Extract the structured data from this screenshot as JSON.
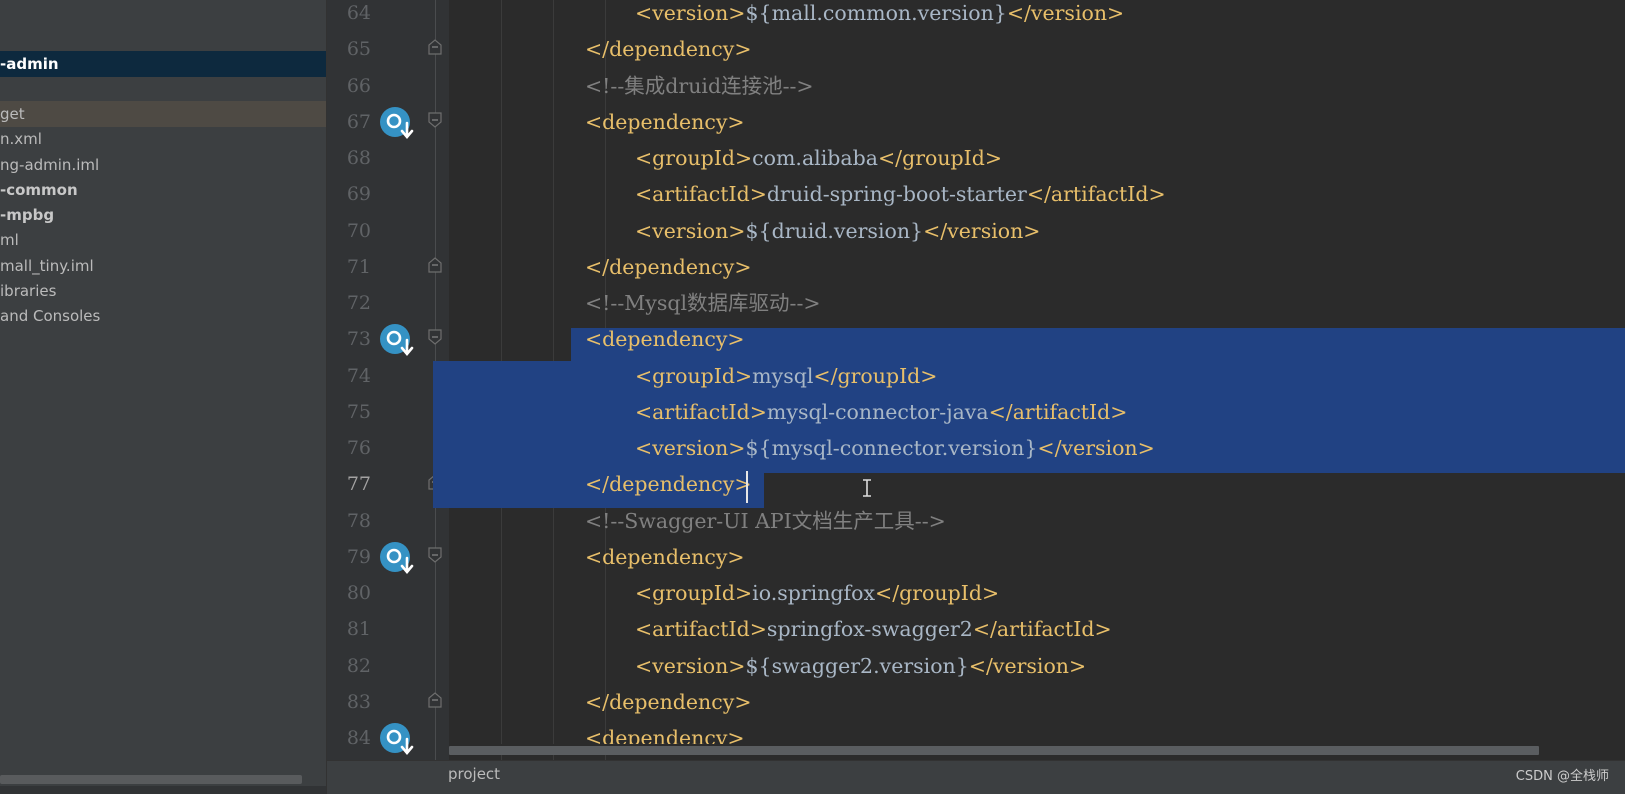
{
  "project_tree": {
    "items": [
      {
        "label": "-admin",
        "state": "selected"
      },
      {
        "label": "get",
        "state": "highlight"
      },
      {
        "label": "n.xml",
        "state": "normal"
      },
      {
        "label": "ng-admin.iml",
        "state": "normal"
      },
      {
        "label": "-common",
        "state": "bold"
      },
      {
        "label": "-mpbg",
        "state": "bold"
      },
      {
        "label": "ml",
        "state": "normal"
      },
      {
        "label": "mall_tiny.iml",
        "state": "normal"
      },
      {
        "label": "ibraries",
        "state": "normal"
      },
      {
        "label": " and Consoles",
        "state": "normal"
      }
    ]
  },
  "editor": {
    "line_numbers": [
      "64",
      "65",
      "66",
      "67",
      "68",
      "69",
      "70",
      "71",
      "72",
      "73",
      "74",
      "75",
      "76",
      "77",
      "78",
      "79",
      "80",
      "81",
      "82",
      "83",
      "84"
    ],
    "current_line": "77",
    "maven_icon_lines": [
      "67",
      "73",
      "79",
      "84"
    ],
    "fold_marker_lines": [
      "65",
      "67",
      "71",
      "73",
      "77",
      "79",
      "83"
    ],
    "lines": [
      {
        "number": "64",
        "indent": 2,
        "tokens": [
          {
            "t": "tag",
            "v": "<version>"
          },
          {
            "t": "txt",
            "v": "${mall.common.version}"
          },
          {
            "t": "tag",
            "v": "</version>"
          }
        ]
      },
      {
        "number": "65",
        "indent": 1,
        "tokens": [
          {
            "t": "tag",
            "v": "</dependency>"
          }
        ]
      },
      {
        "number": "66",
        "indent": 1,
        "tokens": [
          {
            "t": "cmt",
            "v": "<!--集成druid连接池-->"
          }
        ]
      },
      {
        "number": "67",
        "indent": 1,
        "tokens": [
          {
            "t": "tag",
            "v": "<dependency>"
          }
        ]
      },
      {
        "number": "68",
        "indent": 2,
        "tokens": [
          {
            "t": "tag",
            "v": "<groupId>"
          },
          {
            "t": "txt",
            "v": "com.alibaba"
          },
          {
            "t": "tag",
            "v": "</groupId>"
          }
        ]
      },
      {
        "number": "69",
        "indent": 2,
        "tokens": [
          {
            "t": "tag",
            "v": "<artifactId>"
          },
          {
            "t": "txt",
            "v": "druid-spring-boot-starter"
          },
          {
            "t": "tag",
            "v": "</artifactId>"
          }
        ]
      },
      {
        "number": "70",
        "indent": 2,
        "tokens": [
          {
            "t": "tag",
            "v": "<version>"
          },
          {
            "t": "txt",
            "v": "${druid.version}"
          },
          {
            "t": "tag",
            "v": "</version>"
          }
        ]
      },
      {
        "number": "71",
        "indent": 1,
        "tokens": [
          {
            "t": "tag",
            "v": "</dependency>"
          }
        ]
      },
      {
        "number": "72",
        "indent": 1,
        "tokens": [
          {
            "t": "cmt",
            "v": "<!--Mysql数据库驱动-->"
          }
        ]
      },
      {
        "number": "73",
        "indent": 1,
        "tokens": [
          {
            "t": "tag",
            "v": "<dependency>"
          }
        ]
      },
      {
        "number": "74",
        "indent": 2,
        "tokens": [
          {
            "t": "tag",
            "v": "<groupId>"
          },
          {
            "t": "txt",
            "v": "mysql"
          },
          {
            "t": "tag",
            "v": "</groupId>"
          }
        ]
      },
      {
        "number": "75",
        "indent": 2,
        "tokens": [
          {
            "t": "tag",
            "v": "<artifactId>"
          },
          {
            "t": "txt",
            "v": "mysql-connector-java"
          },
          {
            "t": "tag",
            "v": "</artifactId>"
          }
        ]
      },
      {
        "number": "76",
        "indent": 2,
        "tokens": [
          {
            "t": "tag",
            "v": "<version>"
          },
          {
            "t": "txt",
            "v": "${mysql-connector.version}"
          },
          {
            "t": "tag",
            "v": "</version>"
          }
        ]
      },
      {
        "number": "77",
        "indent": 1,
        "tokens": [
          {
            "t": "tag",
            "v": "</dependency>"
          }
        ]
      },
      {
        "number": "78",
        "indent": 1,
        "tokens": [
          {
            "t": "cmt",
            "v": "<!--Swagger-UI API文档生产工具-->"
          }
        ]
      },
      {
        "number": "79",
        "indent": 1,
        "tokens": [
          {
            "t": "tag",
            "v": "<dependency>"
          }
        ]
      },
      {
        "number": "80",
        "indent": 2,
        "tokens": [
          {
            "t": "tag",
            "v": "<groupId>"
          },
          {
            "t": "txt",
            "v": "io.springfox"
          },
          {
            "t": "tag",
            "v": "</groupId>"
          }
        ]
      },
      {
        "number": "81",
        "indent": 2,
        "tokens": [
          {
            "t": "tag",
            "v": "<artifactId>"
          },
          {
            "t": "txt",
            "v": "springfox-swagger2"
          },
          {
            "t": "tag",
            "v": "</artifactId>"
          }
        ]
      },
      {
        "number": "82",
        "indent": 2,
        "tokens": [
          {
            "t": "tag",
            "v": "<version>"
          },
          {
            "t": "txt",
            "v": "${swagger2.version}"
          },
          {
            "t": "tag",
            "v": "</version>"
          }
        ]
      },
      {
        "number": "83",
        "indent": 1,
        "tokens": [
          {
            "t": "tag",
            "v": "</dependency>"
          }
        ]
      },
      {
        "number": "84",
        "indent": 1,
        "tokens": [
          {
            "t": "tag",
            "v": "<dependency>"
          }
        ]
      }
    ],
    "selection": {
      "from_line": "73",
      "to_line": "77"
    }
  },
  "statusbar": {
    "project_label": "project",
    "watermark": "CSDN @全栈师"
  },
  "colors": {
    "background": "#2b2b2b",
    "sidebar": "#3c3f41",
    "selection": "#214283",
    "tag": "#e8bf6a",
    "text": "#a9b7c6",
    "comment": "#808080",
    "maven_icon": "#3592c4"
  }
}
